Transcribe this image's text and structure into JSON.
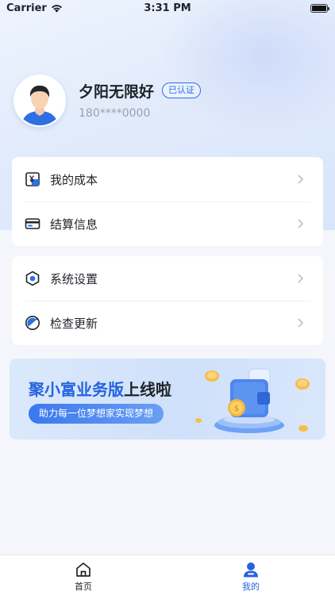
{
  "status_bar": {
    "carrier": "Carrier",
    "time": "3:31 PM"
  },
  "profile": {
    "nickname": "夕阳无限好",
    "verified_badge": "已认证",
    "phone": "180****0000"
  },
  "menu_groups": [
    {
      "items": [
        {
          "label": "我的成本",
          "icon": "cost-icon"
        },
        {
          "label": "结算信息",
          "icon": "card-icon"
        }
      ]
    },
    {
      "items": [
        {
          "label": "系统设置",
          "icon": "settings-icon"
        },
        {
          "label": "检查更新",
          "icon": "update-icon"
        }
      ]
    }
  ],
  "banner": {
    "title_highlight": "聚小富业务版",
    "title_rest": "上线啦",
    "subtitle": "助力每一位梦想家实现梦想"
  },
  "tabbar": {
    "home_label": "首页",
    "mine_label": "我的",
    "active": "mine"
  },
  "colors": {
    "accent": "#2463e0",
    "page_bg": "#f4f6fb",
    "card_bg": "#ffffff"
  }
}
